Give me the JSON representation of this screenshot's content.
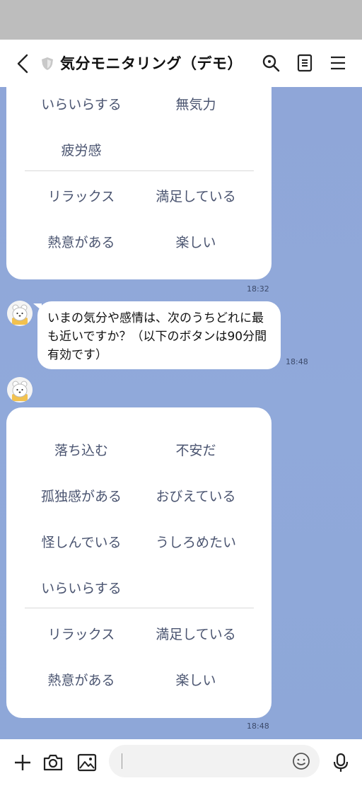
{
  "header": {
    "title": "気分モニタリング（デモ）",
    "icons": [
      "back-icon",
      "shield-icon",
      "search-icon",
      "notes-icon",
      "menu-icon"
    ]
  },
  "card1": {
    "options_top": [
      "いらいらする",
      "無気力",
      "疲労感"
    ],
    "options_bottom": [
      "リラックス",
      "満足している",
      "熱意がある",
      "楽しい"
    ],
    "time": "18:32"
  },
  "message": {
    "text": "いまの気分や感情は、次のうちどれに最も近いですか？（以下のボタンは90分間有効です）",
    "time": "18:48"
  },
  "card2": {
    "options_top": [
      "落ち込む",
      "不安だ",
      "孤独感がある",
      "おびえている",
      "怪しんでいる",
      "うしろめたい",
      "いらいらする"
    ],
    "options_bottom": [
      "リラックス",
      "満足している",
      "熱意がある",
      "楽しい"
    ],
    "time": "18:48"
  },
  "footer": {
    "input_value": "",
    "icons": [
      "plus-icon",
      "camera-icon",
      "image-icon",
      "emoji-icon",
      "mic-icon"
    ]
  }
}
